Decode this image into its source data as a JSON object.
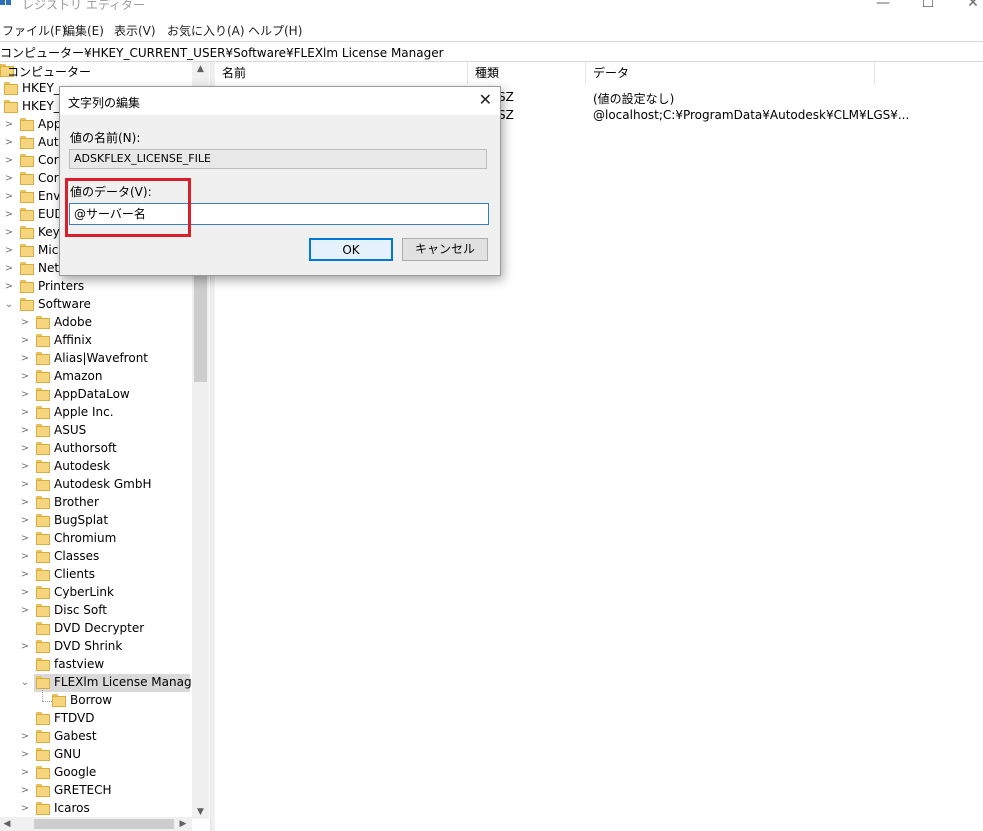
{
  "window": {
    "title": "レジストリ エディター",
    "minimize": "—",
    "maximize": "☐",
    "close": "✕"
  },
  "menu": [
    "ファイル(F)",
    "編集(E)",
    "表示(V)",
    "お気に入り(A)",
    "ヘルプ(H)"
  ],
  "address": "コンピューター¥HKEY_CURRENT_USER¥Software¥FLEXlm License Manager",
  "tree": {
    "root": "コンピューター",
    "hives": [
      "HKEY_",
      "HKEY_"
    ],
    "top_keys": [
      "App",
      "Aut",
      "Cor",
      "Cor",
      "Env",
      "EUD",
      "Key",
      "Mic",
      "Net",
      "Printers",
      "Software"
    ],
    "software_children": [
      "Adobe",
      "Affinix",
      "Alias|Wavefront",
      "Amazon",
      "AppDataLow",
      "Apple Inc.",
      "ASUS",
      "Authorsoft",
      "Autodesk",
      "Autodesk GmbH",
      "Brother",
      "BugSplat",
      "Chromium",
      "Classes",
      "Clients",
      "CyberLink",
      "Disc Soft",
      "DVD Decrypter",
      "DVD Shrink",
      "fastview",
      "FLEXlm License Manager"
    ],
    "flexlm_children": [
      "Borrow"
    ],
    "after_flexlm": [
      "FTDVD",
      "Gabest",
      "GNU",
      "Google",
      "GRETECH",
      "Icaros"
    ]
  },
  "list": {
    "columns": [
      "名前",
      "種類",
      "データ"
    ],
    "rows": [
      {
        "type_fragment": "SZ",
        "data": "(値の設定なし)"
      },
      {
        "type_fragment": "SZ",
        "data": "@localhost;C:¥ProgramData¥Autodesk¥CLM¥LGS¥..."
      }
    ]
  },
  "dialog": {
    "title": "文字列の編集",
    "close": "✕",
    "name_label": "値の名前(N):",
    "name_value": "ADSKFLEX_LICENSE_FILE",
    "data_label": "値のデータ(V):",
    "data_value": "@サーバー名",
    "ok_label": "OK",
    "cancel_label": "キャンセル"
  },
  "colors": {
    "highlight_box": "#d9202a",
    "ok_border": "#0078d7",
    "folder": "#f5d67e"
  }
}
